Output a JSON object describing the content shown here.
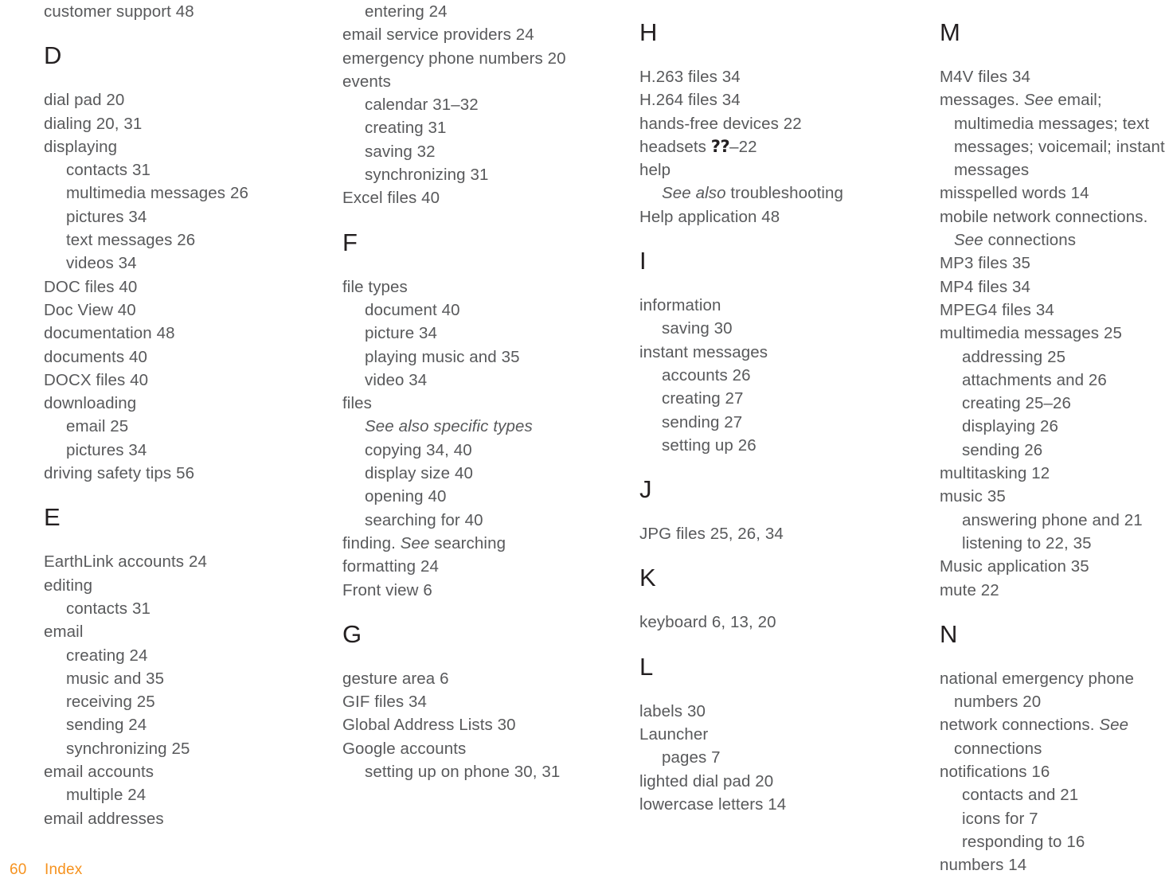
{
  "document": {
    "kind": "index-page",
    "text_color": "#58595b",
    "heading_color": "#231f20",
    "accent_color": "#f6921e"
  },
  "footer": {
    "page_number": "60",
    "section_label": "Index"
  },
  "columns": [
    {
      "id": "column-1",
      "blocks": [
        {
          "type": "entries",
          "entries": [
            {
              "level": "main",
              "text": "customer support 48"
            }
          ]
        },
        {
          "type": "letter",
          "letter": "D",
          "entries": [
            {
              "level": "main",
              "text": "dial pad 20"
            },
            {
              "level": "main",
              "text": "dialing 20, 31"
            },
            {
              "level": "main",
              "text": "displaying"
            },
            {
              "level": "sub",
              "text": "contacts 31"
            },
            {
              "level": "sub",
              "text": "multimedia messages 26"
            },
            {
              "level": "sub",
              "text": "pictures 34"
            },
            {
              "level": "sub",
              "text": "text messages 26"
            },
            {
              "level": "sub",
              "text": "videos 34"
            },
            {
              "level": "main",
              "text": "DOC files 40"
            },
            {
              "level": "main",
              "text": "Doc View 40"
            },
            {
              "level": "main",
              "text": "documentation 48"
            },
            {
              "level": "main",
              "text": "documents 40"
            },
            {
              "level": "main",
              "text": "DOCX files 40"
            },
            {
              "level": "main",
              "text": "downloading"
            },
            {
              "level": "sub",
              "text": "email 25"
            },
            {
              "level": "sub",
              "text": "pictures 34"
            },
            {
              "level": "main",
              "text": "driving safety tips 56"
            }
          ]
        },
        {
          "type": "letter",
          "letter": "E",
          "entries": [
            {
              "level": "main",
              "text": "EarthLink accounts 24"
            },
            {
              "level": "main",
              "text": "editing"
            },
            {
              "level": "sub",
              "text": "contacts 31"
            },
            {
              "level": "main",
              "text": "email"
            },
            {
              "level": "sub",
              "text": "creating 24"
            },
            {
              "level": "sub",
              "text": "music and 35"
            },
            {
              "level": "sub",
              "text": "receiving 25"
            },
            {
              "level": "sub",
              "text": "sending 24"
            },
            {
              "level": "sub",
              "text": "synchronizing 25"
            },
            {
              "level": "main",
              "text": "email accounts"
            },
            {
              "level": "sub",
              "text": "multiple 24"
            },
            {
              "level": "main",
              "text": "email addresses"
            }
          ]
        }
      ]
    },
    {
      "id": "column-2",
      "blocks": [
        {
          "type": "entries",
          "entries": [
            {
              "level": "sub",
              "text": "entering 24"
            },
            {
              "level": "main",
              "text": "email service providers 24"
            },
            {
              "level": "main",
              "text": "emergency phone numbers 20"
            },
            {
              "level": "main",
              "text": "events"
            },
            {
              "level": "sub",
              "text": "calendar 31–32"
            },
            {
              "level": "sub",
              "text": "creating 31"
            },
            {
              "level": "sub",
              "text": "saving 32"
            },
            {
              "level": "sub",
              "text": "synchronizing 31"
            },
            {
              "level": "main",
              "text": "Excel files 40"
            }
          ]
        },
        {
          "type": "letter",
          "letter": "F",
          "entries": [
            {
              "level": "main",
              "text": "file types"
            },
            {
              "level": "sub",
              "text": "document 40"
            },
            {
              "level": "sub",
              "text": "picture 34"
            },
            {
              "level": "sub",
              "text": "playing music and 35"
            },
            {
              "level": "sub",
              "text": "video 34"
            },
            {
              "level": "main",
              "text": "files"
            },
            {
              "level": "sub",
              "text": "See also specific types",
              "style": "all-italic"
            },
            {
              "level": "sub",
              "text": "copying 34, 40"
            },
            {
              "level": "sub",
              "text": "display size 40"
            },
            {
              "level": "sub",
              "text": "opening 40"
            },
            {
              "level": "sub",
              "text": "searching for 40"
            },
            {
              "level": "main",
              "text": "finding. See searching",
              "italic_spans": [
                [
                  "finding. ",
                  false
                ],
                [
                  "See",
                  true
                ],
                [
                  " searching",
                  false
                ]
              ]
            },
            {
              "level": "main",
              "text": "formatting 24"
            },
            {
              "level": "main",
              "text": "Front view 6"
            }
          ]
        },
        {
          "type": "letter",
          "letter": "G",
          "entries": [
            {
              "level": "main",
              "text": "gesture area 6"
            },
            {
              "level": "main",
              "text": "GIF files 34"
            },
            {
              "level": "main",
              "text": "Global Address Lists 30"
            },
            {
              "level": "main",
              "text": "Google accounts"
            },
            {
              "level": "sub",
              "text": "setting up on phone 30, 31"
            }
          ]
        }
      ]
    },
    {
      "id": "column-3",
      "blocks": [
        {
          "type": "letter",
          "letter": "H",
          "top_letter": true,
          "entries": [
            {
              "level": "main",
              "text": "H.263 files 34"
            },
            {
              "level": "main",
              "text": "H.264 files 34"
            },
            {
              "level": "main",
              "text": "hands-free devices 22"
            },
            {
              "level": "main",
              "text": "headsets ??–22",
              "placeholder_spans": [
                [
                  "headsets ",
                  false
                ],
                [
                  "??",
                  true
                ],
                [
                  "–22",
                  false
                ]
              ]
            },
            {
              "level": "main",
              "text": "help"
            },
            {
              "level": "sub",
              "text": "See also troubleshooting",
              "italic_spans": [
                [
                  "See also",
                  true
                ],
                [
                  " troubleshooting",
                  false
                ]
              ]
            },
            {
              "level": "main",
              "text": "Help application 48"
            }
          ]
        },
        {
          "type": "letter",
          "letter": "I",
          "entries": [
            {
              "level": "main",
              "text": "information"
            },
            {
              "level": "sub",
              "text": "saving 30"
            },
            {
              "level": "main",
              "text": "instant messages"
            },
            {
              "level": "sub",
              "text": "accounts 26"
            },
            {
              "level": "sub",
              "text": "creating 27"
            },
            {
              "level": "sub",
              "text": "sending 27"
            },
            {
              "level": "sub",
              "text": "setting up 26"
            }
          ]
        },
        {
          "type": "letter",
          "letter": "J",
          "entries": [
            {
              "level": "main",
              "text": "JPG files 25, 26, 34"
            }
          ]
        },
        {
          "type": "letter",
          "letter": "K",
          "entries": [
            {
              "level": "main",
              "text": "keyboard 6, 13, 20"
            }
          ]
        },
        {
          "type": "letter",
          "letter": "L",
          "entries": [
            {
              "level": "main",
              "text": "labels 30"
            },
            {
              "level": "main",
              "text": "Launcher"
            },
            {
              "level": "sub",
              "text": "pages 7"
            },
            {
              "level": "main",
              "text": "lighted dial pad 20"
            },
            {
              "level": "main",
              "text": "lowercase letters 14"
            }
          ]
        }
      ]
    },
    {
      "id": "column-4",
      "blocks": [
        {
          "type": "letter",
          "letter": "M",
          "top_letter": true,
          "entries": [
            {
              "level": "main",
              "text": "M4V files 34"
            },
            {
              "level": "main",
              "text": "messages. See email; multimedia messages; text messages; voicemail; instant messages",
              "wrap": true,
              "italic_spans": [
                [
                  "messages. ",
                  false
                ],
                [
                  "See",
                  true
                ],
                [
                  " email; multimedia messages; text messages; voicemail; instant messages",
                  false
                ]
              ]
            },
            {
              "level": "main",
              "text": "misspelled words 14"
            },
            {
              "level": "main",
              "text": "mobile network connections. See connections",
              "wrap": true,
              "italic_spans": [
                [
                  "mobile network connections. ",
                  false
                ],
                [
                  "See",
                  true
                ],
                [
                  " connections",
                  false
                ]
              ]
            },
            {
              "level": "main",
              "text": "MP3 files 35"
            },
            {
              "level": "main",
              "text": "MP4 files 34"
            },
            {
              "level": "main",
              "text": "MPEG4 files 34"
            },
            {
              "level": "main",
              "text": "multimedia messages 25"
            },
            {
              "level": "sub",
              "text": "addressing 25"
            },
            {
              "level": "sub",
              "text": "attachments and 26"
            },
            {
              "level": "sub",
              "text": "creating 25–26"
            },
            {
              "level": "sub",
              "text": "displaying 26"
            },
            {
              "level": "sub",
              "text": "sending 26"
            },
            {
              "level": "main",
              "text": "multitasking 12"
            },
            {
              "level": "main",
              "text": "music 35"
            },
            {
              "level": "sub",
              "text": "answering phone and 21"
            },
            {
              "level": "sub",
              "text": "listening to 22, 35"
            },
            {
              "level": "main",
              "text": "Music application 35"
            },
            {
              "level": "main",
              "text": "mute 22"
            }
          ]
        },
        {
          "type": "letter",
          "letter": "N",
          "entries": [
            {
              "level": "main",
              "text": "national emergency phone numbers 20",
              "wrap": true
            },
            {
              "level": "main",
              "text": "network connections. See connections",
              "wrap": true,
              "italic_spans": [
                [
                  "network connections. ",
                  false
                ],
                [
                  "See",
                  true
                ],
                [
                  " connections",
                  false
                ]
              ]
            },
            {
              "level": "main",
              "text": "notifications 16"
            },
            {
              "level": "sub",
              "text": "contacts and 21"
            },
            {
              "level": "sub",
              "text": "icons for 7"
            },
            {
              "level": "sub",
              "text": "responding to 16"
            },
            {
              "level": "main",
              "text": "numbers 14"
            }
          ]
        }
      ]
    }
  ]
}
